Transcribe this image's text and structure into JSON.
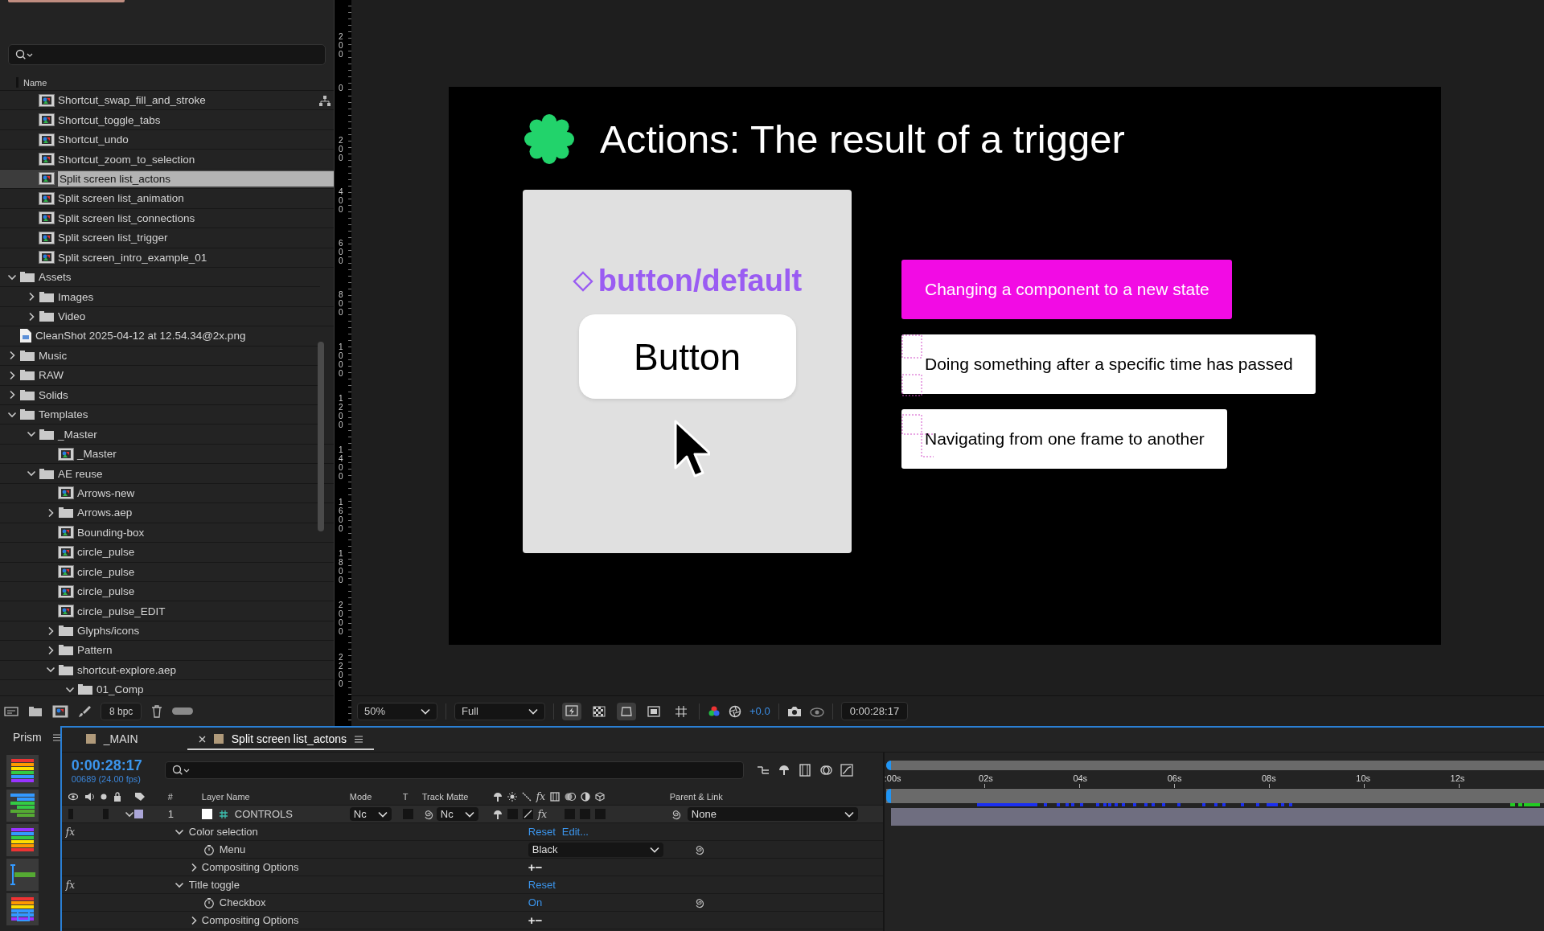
{
  "project": {
    "column_name": "Name",
    "footer_bpc": "8 bpc",
    "footer_toggle_on": false,
    "items": [
      {
        "children": [
          {
            "label": "Shortcut_swap_fill_and_stroke",
            "kind": "comp",
            "selected": false
          },
          {
            "label": "Shortcut_toggle_tabs",
            "kind": "comp",
            "selected": false
          },
          {
            "label": "Shortcut_undo",
            "kind": "comp",
            "selected": false
          },
          {
            "label": "Shortcut_zoom_to_selection",
            "kind": "comp",
            "selected": false
          },
          {
            "label": "Split screen list_actons",
            "kind": "comp",
            "selected": true
          },
          {
            "label": "Split screen list_animation",
            "kind": "comp",
            "selected": false
          },
          {
            "label": "Split screen list_connections",
            "kind": "comp",
            "selected": false
          },
          {
            "label": "Split screen list_trigger",
            "kind": "comp",
            "selected": false
          },
          {
            "label": "Split screen_intro_example_01",
            "kind": "comp",
            "selected": false
          }
        ]
      },
      {
        "label": "Assets",
        "kind": "folder",
        "expanded": true,
        "selected": false,
        "children": [
          {
            "label": "Images",
            "kind": "folder",
            "expanded": false,
            "selected": false
          },
          {
            "label": "Video",
            "kind": "folder",
            "expanded": false,
            "selected": false
          }
        ]
      },
      {
        "label": "CleanShot 2025-04-12 at 12.54.34@2x.png",
        "kind": "file",
        "selected": false
      },
      {
        "label": "Music",
        "kind": "folder",
        "expanded": false,
        "selected": false
      },
      {
        "label": "RAW",
        "kind": "folder",
        "expanded": false,
        "selected": false
      },
      {
        "label": "Solids",
        "kind": "folder",
        "expanded": false,
        "selected": false
      },
      {
        "label": "Templates",
        "kind": "folder",
        "expanded": true,
        "selected": false,
        "children": [
          {
            "label": "_Master",
            "kind": "folder",
            "expanded": true,
            "selected": false,
            "children": [
              {
                "label": "_Master",
                "kind": "comp",
                "selected": false
              }
            ]
          },
          {
            "label": "AE reuse",
            "kind": "folder",
            "expanded": true,
            "selected": false,
            "children": [
              {
                "label": "Arrows-new",
                "kind": "comp",
                "selected": false
              },
              {
                "label": "Arrows.aep",
                "kind": "folder",
                "expanded": false,
                "selected": false
              },
              {
                "label": "Bounding-box",
                "kind": "comp",
                "selected": false
              },
              {
                "label": "circle_pulse",
                "kind": "comp",
                "selected": false
              },
              {
                "label": "circle_pulse",
                "kind": "comp",
                "selected": false
              },
              {
                "label": "circle_pulse",
                "kind": "comp",
                "selected": false
              },
              {
                "label": "circle_pulse_EDIT",
                "kind": "comp",
                "selected": false
              },
              {
                "label": "Glyphs/icons",
                "kind": "folder",
                "expanded": false,
                "selected": false
              },
              {
                "label": "Pattern",
                "kind": "folder",
                "expanded": false,
                "selected": false
              },
              {
                "label": "shortcut-explore.aep",
                "kind": "folder",
                "expanded": true,
                "selected": false,
                "children": [
                  {
                    "label": "01_Comp",
                    "kind": "folder",
                    "expanded": true,
                    "selected": false
                  }
                ]
              }
            ]
          }
        ]
      }
    ]
  },
  "viewer": {
    "ruler_labels": [
      "200",
      "0",
      "200",
      "400",
      "600",
      "800",
      "1000",
      "1200",
      "1400",
      "1600",
      "1800",
      "2000",
      "2200"
    ],
    "composition": {
      "title": "Actions: The result of a trigger",
      "component_label": "button/default",
      "button_label": "Button",
      "options": [
        {
          "label": "Changing a component to a new state",
          "selected": true
        },
        {
          "label": "Doing something after a specific time has passed",
          "selected": false
        },
        {
          "label": "Navigating from one frame to another",
          "selected": false
        }
      ]
    },
    "toolbar": {
      "magnification": "50%",
      "resolution": "Full",
      "exposure": "+0.0",
      "timecode": "0:00:28:17"
    }
  },
  "prism": {
    "title": "Prism"
  },
  "timeline": {
    "tabs": [
      {
        "label": "_MAIN",
        "selected": false
      },
      {
        "label": "Split screen list_actons",
        "selected": true
      }
    ],
    "current_time": "0:00:28:17",
    "frame_info": "00689 (24.00 fps)",
    "columns": {
      "number": "#",
      "layer_name": "Layer Name",
      "mode": "Mode",
      "t": "T",
      "track_matte": "Track Matte",
      "fx": "fx",
      "parent": "Parent & Link"
    },
    "layers": [
      {
        "number": "1",
        "name": "CONTROLS",
        "mode": "Nc",
        "track_matte": "Nc",
        "preserve_transparency": false,
        "effects_switch": "fx",
        "effects_on": true,
        "parent": "None",
        "expanded": true,
        "color": "#aba6d8",
        "children": [
          {
            "kind": "effect",
            "badge": "fx",
            "label": "Color selection",
            "expanded": true,
            "links": [
              "Reset",
              "Edit..."
            ],
            "children": [
              {
                "kind": "dropdown",
                "label": "Menu",
                "value": "Black"
              },
              {
                "kind": "group",
                "label": "Compositing Options",
                "expanded": false,
                "actions": "+−"
              }
            ]
          },
          {
            "kind": "effect",
            "badge": "fx",
            "label": "Title toggle",
            "expanded": true,
            "links": [
              "Reset"
            ],
            "children": [
              {
                "kind": "toggle",
                "label": "Checkbox",
                "value": "On"
              },
              {
                "kind": "group",
                "label": "Compositing Options",
                "expanded": false,
                "actions": "+−"
              }
            ]
          }
        ]
      }
    ],
    "time_ruler": [
      ":00s",
      "02s",
      "04s",
      "06s",
      "08s",
      "10s",
      "12s"
    ]
  }
}
